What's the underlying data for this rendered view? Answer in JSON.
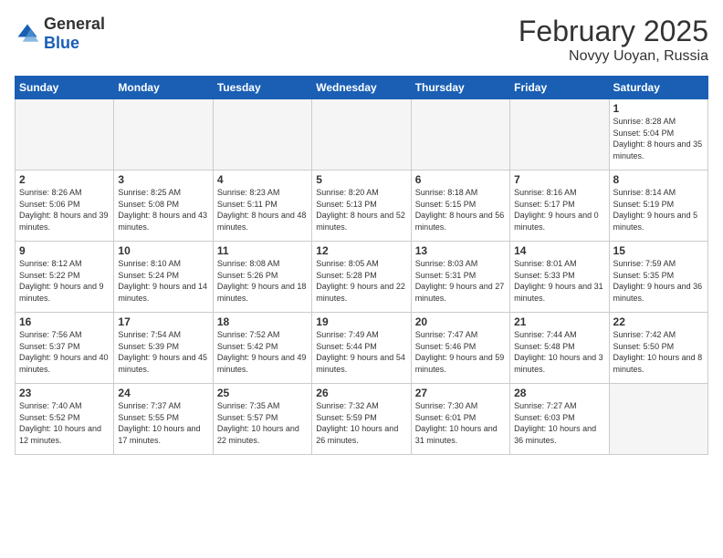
{
  "header": {
    "logo_general": "General",
    "logo_blue": "Blue",
    "month_year": "February 2025",
    "location": "Novyy Uoyan, Russia"
  },
  "days_of_week": [
    "Sunday",
    "Monday",
    "Tuesday",
    "Wednesday",
    "Thursday",
    "Friday",
    "Saturday"
  ],
  "weeks": [
    [
      {
        "day": "",
        "info": ""
      },
      {
        "day": "",
        "info": ""
      },
      {
        "day": "",
        "info": ""
      },
      {
        "day": "",
        "info": ""
      },
      {
        "day": "",
        "info": ""
      },
      {
        "day": "",
        "info": ""
      },
      {
        "day": "1",
        "info": "Sunrise: 8:28 AM\nSunset: 5:04 PM\nDaylight: 8 hours and 35 minutes."
      }
    ],
    [
      {
        "day": "2",
        "info": "Sunrise: 8:26 AM\nSunset: 5:06 PM\nDaylight: 8 hours and 39 minutes."
      },
      {
        "day": "3",
        "info": "Sunrise: 8:25 AM\nSunset: 5:08 PM\nDaylight: 8 hours and 43 minutes."
      },
      {
        "day": "4",
        "info": "Sunrise: 8:23 AM\nSunset: 5:11 PM\nDaylight: 8 hours and 48 minutes."
      },
      {
        "day": "5",
        "info": "Sunrise: 8:20 AM\nSunset: 5:13 PM\nDaylight: 8 hours and 52 minutes."
      },
      {
        "day": "6",
        "info": "Sunrise: 8:18 AM\nSunset: 5:15 PM\nDaylight: 8 hours and 56 minutes."
      },
      {
        "day": "7",
        "info": "Sunrise: 8:16 AM\nSunset: 5:17 PM\nDaylight: 9 hours and 0 minutes."
      },
      {
        "day": "8",
        "info": "Sunrise: 8:14 AM\nSunset: 5:19 PM\nDaylight: 9 hours and 5 minutes."
      }
    ],
    [
      {
        "day": "9",
        "info": "Sunrise: 8:12 AM\nSunset: 5:22 PM\nDaylight: 9 hours and 9 minutes."
      },
      {
        "day": "10",
        "info": "Sunrise: 8:10 AM\nSunset: 5:24 PM\nDaylight: 9 hours and 14 minutes."
      },
      {
        "day": "11",
        "info": "Sunrise: 8:08 AM\nSunset: 5:26 PM\nDaylight: 9 hours and 18 minutes."
      },
      {
        "day": "12",
        "info": "Sunrise: 8:05 AM\nSunset: 5:28 PM\nDaylight: 9 hours and 22 minutes."
      },
      {
        "day": "13",
        "info": "Sunrise: 8:03 AM\nSunset: 5:31 PM\nDaylight: 9 hours and 27 minutes."
      },
      {
        "day": "14",
        "info": "Sunrise: 8:01 AM\nSunset: 5:33 PM\nDaylight: 9 hours and 31 minutes."
      },
      {
        "day": "15",
        "info": "Sunrise: 7:59 AM\nSunset: 5:35 PM\nDaylight: 9 hours and 36 minutes."
      }
    ],
    [
      {
        "day": "16",
        "info": "Sunrise: 7:56 AM\nSunset: 5:37 PM\nDaylight: 9 hours and 40 minutes."
      },
      {
        "day": "17",
        "info": "Sunrise: 7:54 AM\nSunset: 5:39 PM\nDaylight: 9 hours and 45 minutes."
      },
      {
        "day": "18",
        "info": "Sunrise: 7:52 AM\nSunset: 5:42 PM\nDaylight: 9 hours and 49 minutes."
      },
      {
        "day": "19",
        "info": "Sunrise: 7:49 AM\nSunset: 5:44 PM\nDaylight: 9 hours and 54 minutes."
      },
      {
        "day": "20",
        "info": "Sunrise: 7:47 AM\nSunset: 5:46 PM\nDaylight: 9 hours and 59 minutes."
      },
      {
        "day": "21",
        "info": "Sunrise: 7:44 AM\nSunset: 5:48 PM\nDaylight: 10 hours and 3 minutes."
      },
      {
        "day": "22",
        "info": "Sunrise: 7:42 AM\nSunset: 5:50 PM\nDaylight: 10 hours and 8 minutes."
      }
    ],
    [
      {
        "day": "23",
        "info": "Sunrise: 7:40 AM\nSunset: 5:52 PM\nDaylight: 10 hours and 12 minutes."
      },
      {
        "day": "24",
        "info": "Sunrise: 7:37 AM\nSunset: 5:55 PM\nDaylight: 10 hours and 17 minutes."
      },
      {
        "day": "25",
        "info": "Sunrise: 7:35 AM\nSunset: 5:57 PM\nDaylight: 10 hours and 22 minutes."
      },
      {
        "day": "26",
        "info": "Sunrise: 7:32 AM\nSunset: 5:59 PM\nDaylight: 10 hours and 26 minutes."
      },
      {
        "day": "27",
        "info": "Sunrise: 7:30 AM\nSunset: 6:01 PM\nDaylight: 10 hours and 31 minutes."
      },
      {
        "day": "28",
        "info": "Sunrise: 7:27 AM\nSunset: 6:03 PM\nDaylight: 10 hours and 36 minutes."
      },
      {
        "day": "",
        "info": ""
      }
    ]
  ]
}
